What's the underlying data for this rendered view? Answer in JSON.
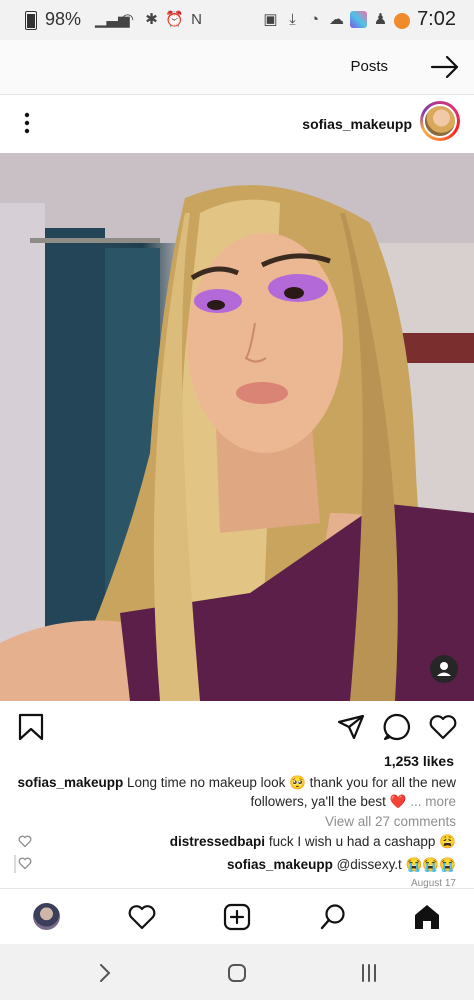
{
  "status_bar": {
    "time": "7:02",
    "battery": "98%",
    "icons": [
      "gallery-icon",
      "download-icon",
      "messenger-icon",
      "weather-icon",
      "snapchat-icon",
      "app-icon",
      "notification-dot",
      "nfc-icon",
      "alarm-icon",
      "bluetooth-icon",
      "wifi-icon",
      "signal-icon",
      "battery-icon"
    ],
    "accent_dot_color": "#f08a2a"
  },
  "header": {
    "title": "Posts"
  },
  "post": {
    "username": "sofias_makeupp",
    "likes": "1,253 likes",
    "caption": {
      "username": "sofias_makeupp",
      "text": "Long time no makeup look 🥺 thank you for all the new followers, ya'll the best ❤️",
      "more": "... more"
    },
    "view_comments": "View all 27 comments",
    "comments": [
      {
        "username": "distressedbapi",
        "text": "fuck I wish u had a cashapp 😩"
      },
      {
        "username": "sofias_makeupp",
        "text": "@dissexy.t 😭😭😭"
      }
    ],
    "date": "August 17"
  },
  "colors": {
    "text": "#262626",
    "muted": "#8e8e8e",
    "heart_red": "#e0245e"
  }
}
